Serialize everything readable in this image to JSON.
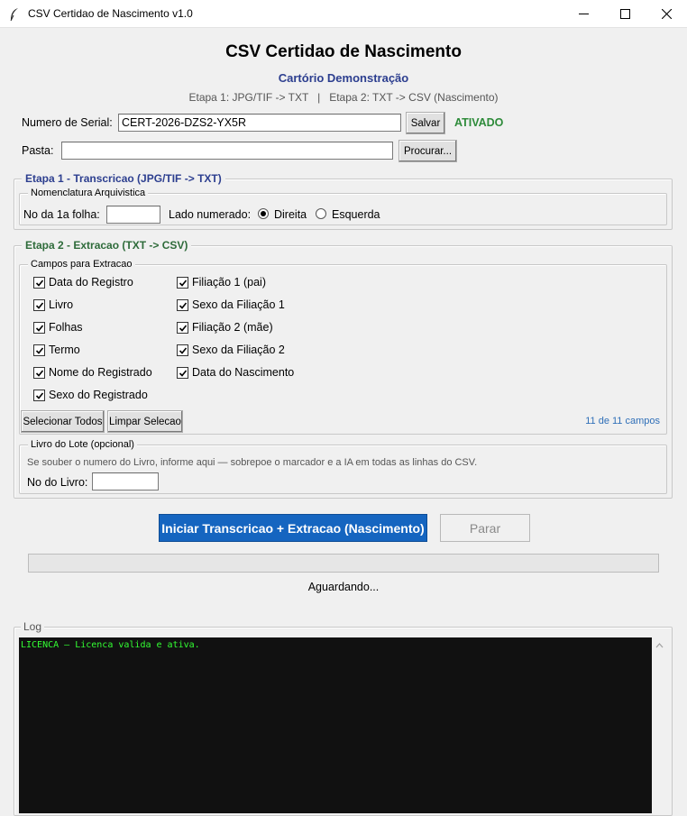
{
  "window": {
    "title": "CSV Certidao de Nascimento v1.0",
    "icon": "feather-icon"
  },
  "header": {
    "heading": "CSV Certidao de Nascimento",
    "org_name": "Cartório Demonstração",
    "steps_info": "Etapa 1: JPG/TIF -> TXT   |   Etapa 2: TXT -> CSV (Nascimento)"
  },
  "serial": {
    "label": "Numero de Serial:",
    "value": "CERT-2026-DZS2-YX5R",
    "save_label": "Salvar",
    "status": "ATIVADO",
    "status_color": "#2e8b3a"
  },
  "folder": {
    "label": "Pasta:",
    "value": "",
    "browse_label": "Procurar..."
  },
  "stage1": {
    "title": "Etapa 1 - Transcricao  (JPG/TIF -> TXT)",
    "title_color": "#2c3e8f",
    "nomenclature_title": "Nomenclatura Arquivistica",
    "first_sheet_label": "No da 1a folha:",
    "first_sheet_value": "",
    "side_label": "Lado numerado:",
    "side_options": [
      "Direita",
      "Esquerda"
    ],
    "side_selected": "Direita"
  },
  "stage2": {
    "title": "Etapa 2 - Extracao  (TXT -> CSV)",
    "title_color": "#2e6b3a",
    "fields_title": "Campos para Extracao",
    "fields_left": [
      {
        "label": "Data do Registro",
        "checked": true
      },
      {
        "label": "Livro",
        "checked": true
      },
      {
        "label": "Folhas",
        "checked": true
      },
      {
        "label": "Termo",
        "checked": true
      },
      {
        "label": "Nome do Registrado",
        "checked": true
      },
      {
        "label": "Sexo do Registrado",
        "checked": true
      }
    ],
    "fields_right": [
      {
        "label": "Filiação 1 (pai)",
        "checked": true
      },
      {
        "label": "Sexo da Filiação 1",
        "checked": true
      },
      {
        "label": "Filiação 2 (mãe)",
        "checked": true
      },
      {
        "label": "Sexo da Filiação 2",
        "checked": true
      },
      {
        "label": "Data do Nascimento",
        "checked": true
      }
    ],
    "select_all_label": "Selecionar Todos",
    "clear_label": "Limpar Selecao",
    "count_text": "11 de 11 campos",
    "count_color": "#2f6fb8",
    "book_title": "Livro do Lote (opcional)",
    "book_hint": "Se souber o numero do Livro, informe aqui — sobrepoe o marcador e a IA em todas as linhas do CSV.",
    "book_label": "No do Livro:",
    "book_value": ""
  },
  "actions": {
    "start_label": "Iniciar Transcricao + Extracao (Nascimento)",
    "start_color": "#1565c0",
    "stop_label": "Parar",
    "progress": 0,
    "status_text": "Aguardando..."
  },
  "log": {
    "title": "Log",
    "lines": [
      "LICENCA — Licenca valida e ativa."
    ],
    "text_color": "#33ff33",
    "background": "#111111"
  }
}
